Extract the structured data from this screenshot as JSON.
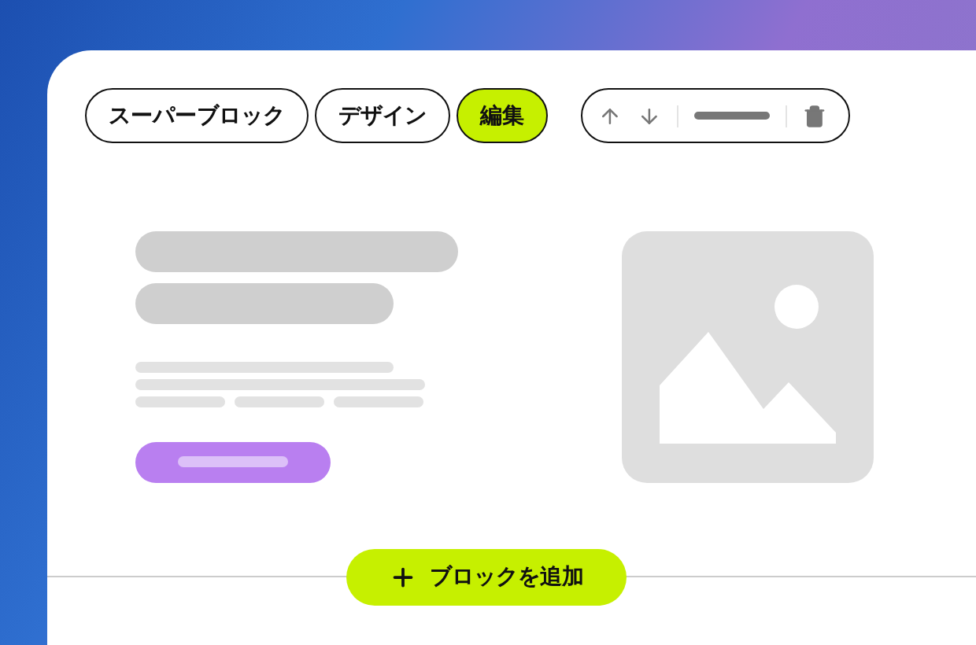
{
  "tabs": [
    {
      "label": "スーパーブロック",
      "selected": false
    },
    {
      "label": "デザイン",
      "selected": false
    },
    {
      "label": "編集",
      "selected": true
    }
  ],
  "add_button": {
    "label": "ブロックを追加"
  }
}
